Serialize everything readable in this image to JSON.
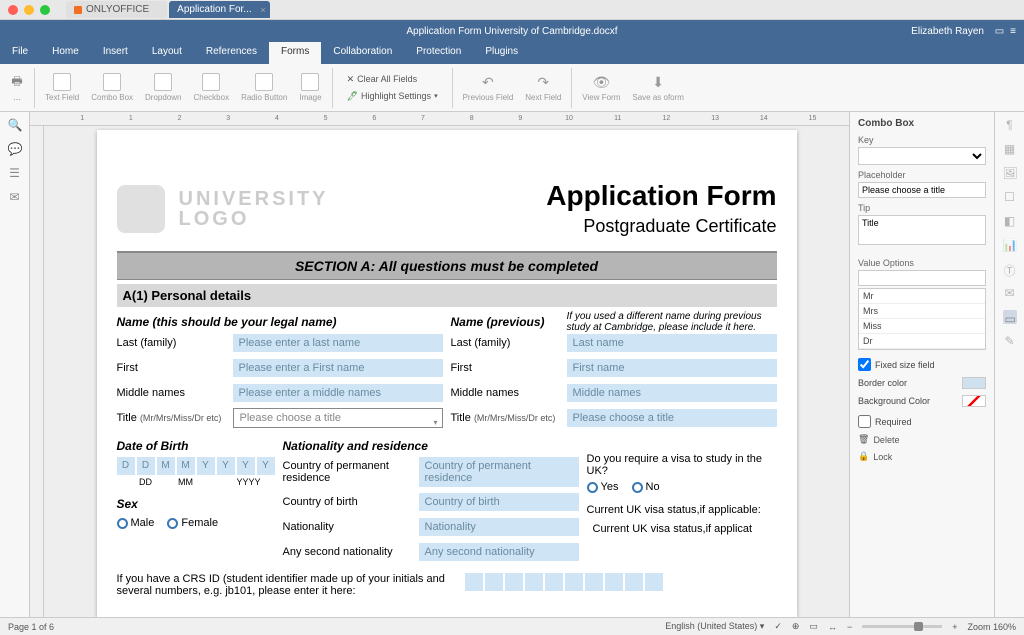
{
  "tabs": {
    "onlyoffice": "ONLYOFFICE",
    "doc": "Application For..."
  },
  "titlebar": {
    "filename": "Application Form University of Cambridge.docxf",
    "user": "Elizabeth Rayen"
  },
  "menu": [
    "File",
    "Home",
    "Insert",
    "Layout",
    "References",
    "Forms",
    "Collaboration",
    "Protection",
    "Plugins"
  ],
  "menu_active_index": 5,
  "ribbon": {
    "textfield": "Text Field",
    "combo": "Combo Box",
    "dropdown": "Dropdown",
    "checkbox": "Checkbox",
    "radio": "Radio Button",
    "image": "Image",
    "clear": "Clear All Fields",
    "highlight": "Highlight Settings",
    "prev": "Previous Field",
    "next": "Next Field",
    "view": "View Form",
    "save": "Save as oform"
  },
  "ruler": [
    "1",
    "",
    "1",
    "",
    "2",
    "",
    "3",
    "",
    "4",
    "",
    "5",
    "",
    "6",
    "",
    "7",
    "",
    "8",
    "",
    "9",
    "",
    "10",
    "",
    "11",
    "",
    "12",
    "",
    "13",
    "",
    "14",
    "",
    "15",
    ""
  ],
  "doc": {
    "logo": "UNIVERSITY\nLOGO",
    "title": "Application Form",
    "subtitle": "Postgraduate Certificate",
    "sectionA": "SECTION A: All questions must be completed",
    "a1": "A(1) Personal details",
    "name_legal": "Name (this should be your legal name)",
    "name_prev": "Name (previous)",
    "name_prev_note": "If you used a different name during previous study at Cambridge, please include it here.",
    "last": "Last (family)",
    "first": "First",
    "middle": "Middle names",
    "title_f": "Title",
    "title_hint": "(Mr/Mrs/Miss/Dr etc)",
    "ph_last": "Please enter a last name",
    "ph_first": "Please enter a First name",
    "ph_middle": "Please enter a middle names",
    "ph_title": "Please choose a title",
    "ph_last2": "Last name",
    "ph_first2": "First name",
    "ph_middle2": "Middle names",
    "ph_title2": "Please choose a title",
    "dob": "Date of Birth",
    "nat": "Nationality and residence",
    "visa_q": "Do you require a visa to study in the UK?",
    "cntry_perm": "Country of permanent residence",
    "cntry_birth": "Country of birth",
    "nationality": "Nationality",
    "second_nat": "Any second nationality",
    "sex": "Sex",
    "male": "Male",
    "female": "Female",
    "yes": "Yes",
    "no": "No",
    "visa_status": "Current UK visa status,if applicable:",
    "visa_ph": "Current UK visa status,if applicat",
    "dob_d": "D",
    "dob_m": "M",
    "dob_y": "Y",
    "dd": "DD",
    "mm": "MM",
    "yyyy": "YYYY",
    "crs_note": "If you have a CRS ID (student identifier made up of your initials and several numbers, e.g. jb101, please enter it here:"
  },
  "rpanel": {
    "title": "Combo Box",
    "key": "Key",
    "placeholder": "Placeholder",
    "ph_val": "Please choose a title",
    "tip": "Tip",
    "tip_val": "Title",
    "value_opts": "Value Options",
    "options": [
      "Mr",
      "Mrs",
      "Miss",
      "Dr"
    ],
    "fixed": "Fixed size field",
    "border": "Border color",
    "bg": "Background Color",
    "required": "Required",
    "delete": "Delete",
    "lock": "Lock"
  },
  "status": {
    "page": "Page 1 of 6",
    "lang": "English (United States)",
    "zoom": "Zoom 160%"
  }
}
